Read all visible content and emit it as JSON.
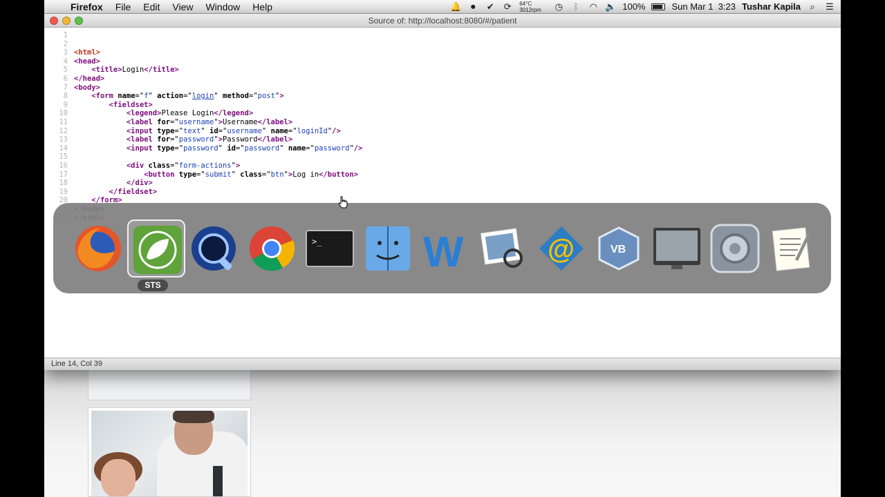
{
  "menubar": {
    "app_name": "Firefox",
    "menus": [
      "File",
      "Edit",
      "View",
      "Window",
      "Help"
    ],
    "temperature": "64°C",
    "fan_speed": "3012rpm",
    "battery": "100%",
    "datetime": "Sun Mar 1  3:23",
    "user": "Tushar Kapila"
  },
  "window": {
    "title": "Source of: http://localhost:8080/#/patient",
    "status": "Line 14, Col 39"
  },
  "source_lines": [
    {
      "n": "1",
      "html": ""
    },
    {
      "n": "2",
      "html": ""
    },
    {
      "n": "3",
      "html": "<span class=\"tag root\">&lt;html&gt;</span>"
    },
    {
      "n": "4",
      "html": "<span class=\"tag\">&lt;head&gt;</span>"
    },
    {
      "n": "5",
      "html": "    <span class=\"tag\">&lt;title&gt;</span>Login<span class=\"tag\">&lt;/title&gt;</span>"
    },
    {
      "n": "6",
      "html": "<span class=\"tag\">&lt;/head&gt;</span>"
    },
    {
      "n": "7",
      "html": "<span class=\"tag\">&lt;body&gt;</span>"
    },
    {
      "n": "8",
      "html": "    <span class=\"tag\">&lt;form</span> <span class=\"attr\">name</span>=\"<span class=\"val\">f</span>\" <span class=\"attr\">action</span>=\"<span class=\"link\">login</span>\" <span class=\"attr\">method</span>=\"<span class=\"val\">post</span>\"<span class=\"tag\">&gt;</span>"
    },
    {
      "n": "9",
      "html": "        <span class=\"tag\">&lt;fieldset&gt;</span>"
    },
    {
      "n": "10",
      "html": "            <span class=\"tag\">&lt;legend&gt;</span>Please Login<span class=\"tag\">&lt;/legend&gt;</span>"
    },
    {
      "n": "11",
      "html": "            <span class=\"tag\">&lt;label</span> <span class=\"attr\">for</span>=\"<span class=\"val\">username</span>\"<span class=\"tag\">&gt;</span>Username<span class=\"tag\">&lt;/label&gt;</span>"
    },
    {
      "n": "12",
      "html": "            <span class=\"tag\">&lt;input</span> <span class=\"attr\">type</span>=\"<span class=\"val\">text</span>\" <span class=\"attr\">id</span>=\"<span class=\"val\">username</span>\" <span class=\"attr\">name</span>=\"<span class=\"val\">loginId</span>\"<span class=\"tag\">/&gt;</span>"
    },
    {
      "n": "13",
      "html": "            <span class=\"tag\">&lt;label</span> <span class=\"attr\">for</span>=\"<span class=\"val\">password</span>\"<span class=\"tag\">&gt;</span>Password<span class=\"tag\">&lt;/label&gt;</span>"
    },
    {
      "n": "14",
      "html": "            <span class=\"tag\">&lt;input</span> <span class=\"attr\">type</span>=\"<span class=\"val\">password</span>\" <span class=\"attr\">id</span>=\"<span class=\"val\">password</span>\" <span class=\"attr\">name</span>=\"<span class=\"val\">password</span>\"<span class=\"tag\">/&gt;</span>"
    },
    {
      "n": "15",
      "html": ""
    },
    {
      "n": "16",
      "html": "            <span class=\"tag\">&lt;div</span> <span class=\"attr\">class</span>=\"<span class=\"val\">form-actions</span>\"<span class=\"tag\">&gt;</span>"
    },
    {
      "n": "17",
      "html": "                <span class=\"tag\">&lt;button</span> <span class=\"attr\">type</span>=\"<span class=\"val\">submit</span>\" <span class=\"attr\">class</span>=\"<span class=\"val\">btn</span>\"<span class=\"tag\">&gt;</span>Log in<span class=\"tag\">&lt;/button&gt;</span>"
    },
    {
      "n": "18",
      "html": "            <span class=\"tag\">&lt;/div&gt;</span>"
    },
    {
      "n": "19",
      "html": "        <span class=\"tag\">&lt;/fieldset&gt;</span>"
    },
    {
      "n": "20",
      "html": "    <span class=\"tag\">&lt;/form&gt;</span>"
    },
    {
      "n": "21",
      "html": "<span class=\"tag\">&lt;/body&gt;</span>"
    },
    {
      "n": "22",
      "html": "<span class=\"tag\">&lt;/html&gt;</span>"
    }
  ],
  "switcher": {
    "selected_label": "STS",
    "apps": [
      {
        "icon": "firefox-icon"
      },
      {
        "icon": "sts-spring-icon",
        "selected": true
      },
      {
        "icon": "quicktime-icon"
      },
      {
        "icon": "chrome-icon"
      },
      {
        "icon": "terminal-icon"
      },
      {
        "icon": "finder-icon"
      },
      {
        "icon": "word-icon"
      },
      {
        "icon": "preview-icon"
      },
      {
        "icon": "mail-client-icon"
      },
      {
        "icon": "virtualbox-icon"
      },
      {
        "icon": "screen-sharing-icon"
      },
      {
        "icon": "system-preferences-icon"
      },
      {
        "icon": "textedit-icon"
      }
    ]
  },
  "colors": {
    "tag": "#7d0d7d",
    "root_tag": "#c2311d",
    "value": "#1a3fb5"
  }
}
